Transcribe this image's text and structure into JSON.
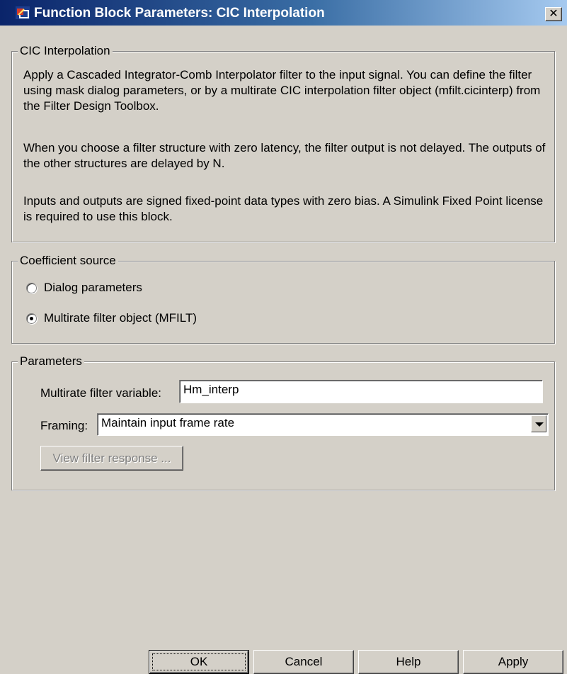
{
  "window": {
    "title": "Function Block Parameters: CIC Interpolation",
    "close_glyph": "✕",
    "title_bar_colors": [
      "#0a246a",
      "#a6caf0"
    ]
  },
  "description_group": {
    "label": "CIC Interpolation",
    "paragraphs": [
      "Apply a Cascaded Integrator-Comb Interpolator filter to the input signal. You can define the filter using mask dialog parameters, or by a multirate CIC interpolation filter object (mfilt.cicinterp) from the Filter Design Toolbox.",
      "When you choose a filter structure with zero latency, the filter output is not delayed. The outputs of the other structures are delayed by N.",
      "Inputs and outputs are signed fixed-point data types with zero bias.  A Simulink Fixed Point license is required to use this block."
    ]
  },
  "coefficient_group": {
    "label": "Coefficient source",
    "options": [
      {
        "label": "Dialog parameters",
        "selected": false
      },
      {
        "label": "Multirate filter object (MFILT)",
        "selected": true
      }
    ]
  },
  "parameters_group": {
    "label": "Parameters",
    "filter_variable_label": "Multirate filter variable:",
    "filter_variable_value": "Hm_interp",
    "framing_label": "Framing:",
    "framing_value": "Maintain input frame rate",
    "view_button": "View filter response ..."
  },
  "buttons": {
    "ok": "OK",
    "cancel": "Cancel",
    "help": "Help",
    "apply": "Apply"
  }
}
